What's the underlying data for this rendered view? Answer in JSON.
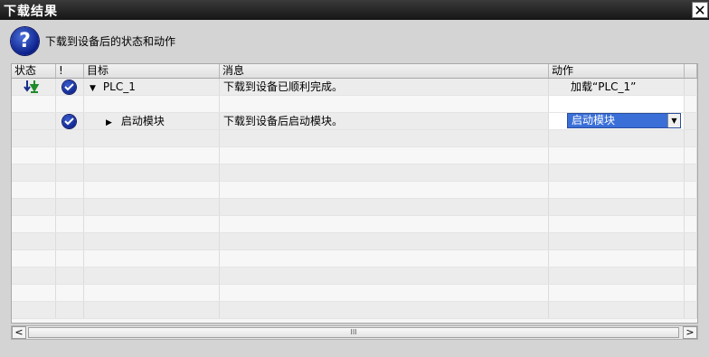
{
  "window": {
    "title": "下载结果",
    "close_label": "✕"
  },
  "header": {
    "text": "下载到设备后的状态和动作"
  },
  "table": {
    "columns": {
      "status": "状态",
      "alert": "!",
      "target": "目标",
      "message": "消息",
      "action": "动作"
    },
    "rows": [
      {
        "target": "PLC_1",
        "message": "下载到设备已顺利完成。",
        "action": "加载“PLC_1”"
      },
      {
        "target": "启动模块",
        "message": "下载到设备后启动模块。",
        "action": "启动模块"
      }
    ]
  },
  "scrollbar": {
    "left": "<",
    "right": ">",
    "thumb": "III"
  },
  "colors": {
    "titlebar": "#1e1e1e",
    "accent": "#3a6fd8",
    "check": "#0e238c"
  }
}
